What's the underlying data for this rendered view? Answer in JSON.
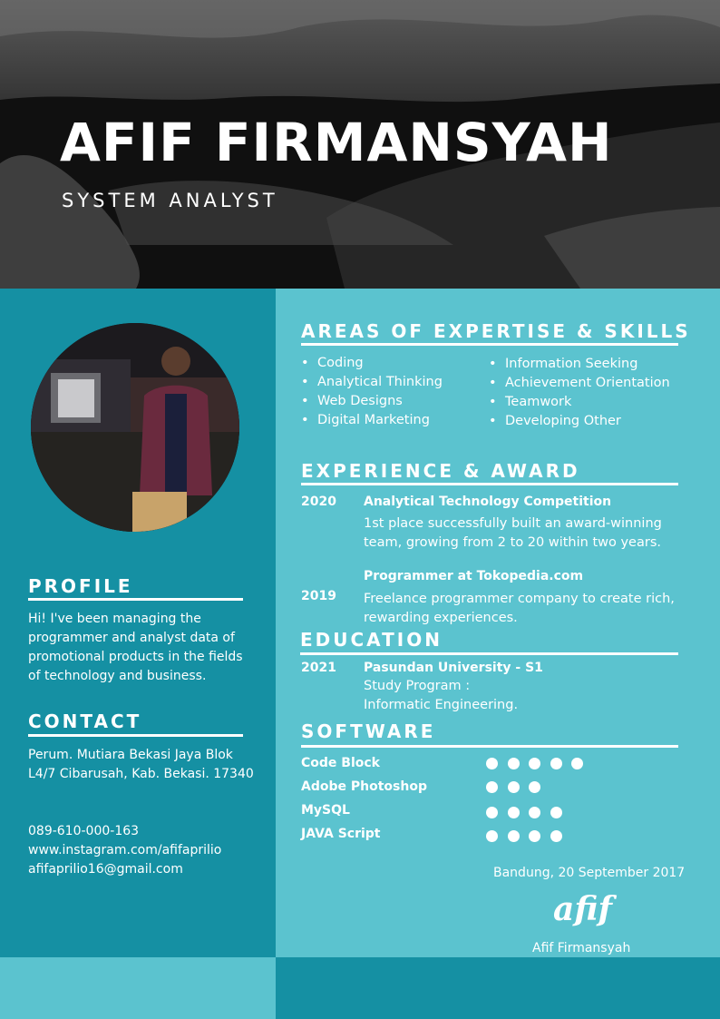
{
  "header": {
    "name": "AFIF FIRMANSYAH",
    "role": "SYSTEM ANALYST"
  },
  "profile": {
    "title": "PROFILE",
    "text": "Hi! I've been managing the programmer and analyst data of promotional products in the fields of technology and business."
  },
  "contact": {
    "title": "CONTACT",
    "address": "Perum. Mutiara Bekasi Jaya Blok L4/7 Cibarusah, Kab. Bekasi. 17340",
    "phone": "089-610-000-163",
    "instagram": "www.instagram.com/afifaprilio",
    "email": "afifaprilio16@gmail.com"
  },
  "skills": {
    "title": "AREAS OF EXPERTISE & SKILLS",
    "col1": [
      "Coding",
      "Analytical Thinking",
      "Web Designs",
      "Digital Marketing"
    ],
    "col2": [
      "Information Seeking",
      "Achievement Orientation",
      "Teamwork",
      "Developing Other"
    ]
  },
  "experience": {
    "title": "EXPERIENCE & AWARD",
    "items": [
      {
        "year": "2020",
        "title": "Analytical Technology Competition",
        "desc": "1st place successfully built an award-winning team, growing from 2 to 20 within two years."
      },
      {
        "year": "2019",
        "title": "Programmer at Tokopedia.com",
        "desc": "Freelance programmer company to create rich, rewarding experiences."
      }
    ]
  },
  "education": {
    "title": "EDUCATION",
    "year": "2021",
    "school": "Pasundan University - S1",
    "line1": "Study Program :",
    "line2": "Informatic Engineering."
  },
  "software": {
    "title": "SOFTWARE",
    "items": [
      {
        "name": "Code Block",
        "level": 5
      },
      {
        "name": "Adobe Photoshop",
        "level": 3
      },
      {
        "name": "MySQL",
        "level": 4
      },
      {
        "name": "JAVA Script",
        "level": 4
      }
    ]
  },
  "signoff": {
    "date": "Bandung, 20 September 2017",
    "signature": "afif",
    "name": "Afif Firmansyah"
  },
  "colors": {
    "dark_teal": "#1590a3",
    "light_teal": "#5bc3cf"
  },
  "icons": {
    "bullet": "bullet-icon",
    "level_dot": "level-dot-icon"
  }
}
